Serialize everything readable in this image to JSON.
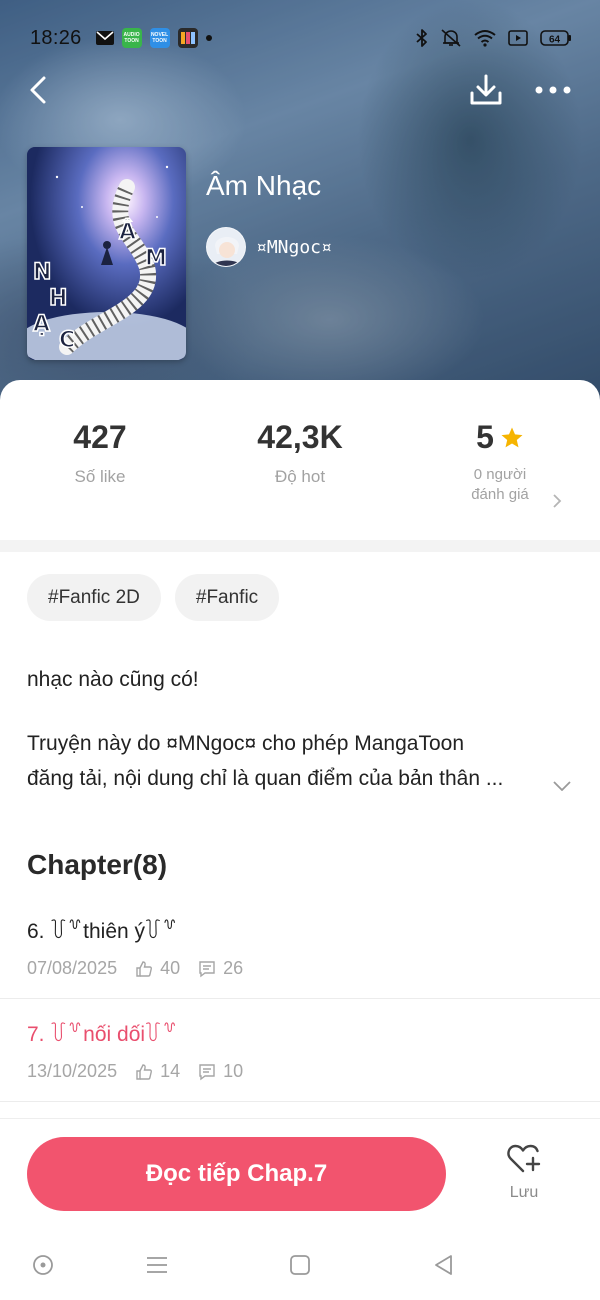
{
  "status_bar": {
    "time": "18:26",
    "app_badges": [
      "AUDIO TOON",
      "NOVEL TOON"
    ],
    "battery": "64"
  },
  "book": {
    "title": "Âm Nhạc",
    "author": "¤MNgoc¤",
    "cover_letters": [
      "Â",
      "M",
      "N",
      "H",
      "Ạ",
      "C"
    ]
  },
  "stats": {
    "likes_value": "427",
    "likes_label": "Số like",
    "hot_value": "42,3K",
    "hot_label": "Độ hot",
    "rating_value": "5",
    "rating_label_line1": "0 người",
    "rating_label_line2": "đánh giá"
  },
  "tags": [
    "#Fanfic 2D",
    "#Fanfic"
  ],
  "description": {
    "line1": "nhạc nào cũng có!",
    "line2": "Truyện này do ¤MNgoc¤ cho phép MangaToon",
    "line3": "đăng tải, nội dung chỉ là quan điểm của bản thân ..."
  },
  "chapters": {
    "heading": "Chapter(8)",
    "items": [
      {
        "title": "6. ꒦꒷thiên ý꒦꒷",
        "date": "07/08/2025",
        "likes": "40",
        "comments": "26",
        "active": false
      },
      {
        "title": "7. ꒦꒷nối dối꒦꒷",
        "date": "13/10/2025",
        "likes": "14",
        "comments": "10",
        "active": true
      }
    ]
  },
  "bottom_bar": {
    "read_button": "Đọc tiếp Chap.7",
    "save_label": "Lưu"
  },
  "colors": {
    "accent": "#f2546e",
    "active_chapter": "#e94f6e",
    "star": "#f6b400"
  }
}
